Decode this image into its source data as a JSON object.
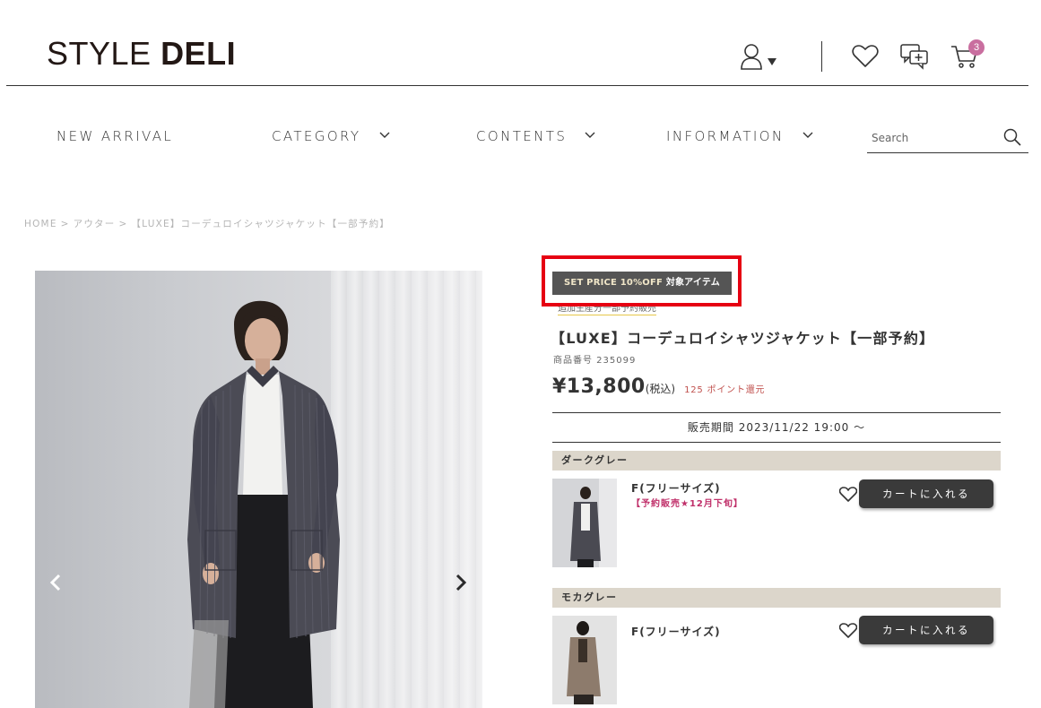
{
  "header": {
    "logo_light": "STYLE ",
    "logo_bold": "DELI",
    "cart_count": "3",
    "icons": [
      "user-icon",
      "caret-down-icon",
      "heart-icon",
      "chat-add-icon",
      "cart-icon"
    ]
  },
  "nav": {
    "items": [
      {
        "label": "NEW ARRIVAL"
      },
      {
        "label": "CATEGORY"
      },
      {
        "label": "CONTENTS"
      },
      {
        "label": "INFORMATION"
      }
    ],
    "search_placeholder": "Search"
  },
  "breadcrumb": {
    "items": [
      "HOME",
      "アウター",
      "【LUXE】コーデュロイシャツジャケット【一部予約】"
    ],
    "separator": ">"
  },
  "product": {
    "promo_en": "SET PRICE 10%OFF",
    "promo_jp": " 対象アイテム",
    "sub_tag": "追加生産分一部予約販売",
    "title": "【LUXE】コーデュロイシャツジャケット【一部予約】",
    "code": "商品番号 235099",
    "price": "¥13,800",
    "tax_label": "(税込)",
    "points": "125 ポイント還元",
    "sale_period": "販売期間 2023/11/22 19:00 〜",
    "variants": [
      {
        "color": "ダークグレー",
        "size": "F(フリーサイズ)",
        "note": "【予約販売★12月下旬】",
        "cart_label": "カートに入れる",
        "swatch": "#4a4a52"
      },
      {
        "color": "モカグレー",
        "size": "F(フリーサイズ)",
        "note": "",
        "cart_label": "カートに入れる",
        "swatch": "#8d7b6c"
      }
    ]
  },
  "colors": {
    "accent_badge": "#c96e9f",
    "highlight_frame": "#e60012",
    "color_bar": "#dcd6cb",
    "button": "#3a3a3a",
    "preorder_text": "#c0306a",
    "points_text": "#c0504d"
  }
}
